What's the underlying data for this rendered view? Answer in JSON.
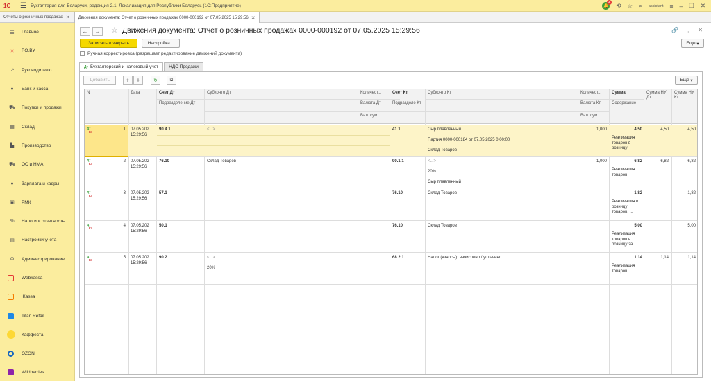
{
  "app": {
    "logo": "1С",
    "title": "Бухгалтерия для Беларуси, редакция 2.1. Локализация для Республики Беларусь  (1С:Предприятие)",
    "notif_count": "4",
    "user": "assistant"
  },
  "tabs": [
    {
      "label": "Отчеты о розничных продажах"
    },
    {
      "label": "Движения документа: Отчет о розничных продажах 0000-000192 от 07.05.2025 15:29:56"
    }
  ],
  "sidebar": {
    "items": [
      {
        "label": "Главное",
        "icon": "menu-icon"
      },
      {
        "label": "PO.BY",
        "icon": "asterisk-icon"
      },
      {
        "label": "Руководителю",
        "icon": "trend-icon"
      },
      {
        "label": "Банк и касса",
        "icon": "coin-icon"
      },
      {
        "label": "Покупки и продажи",
        "icon": "cart-icon"
      },
      {
        "label": "Склад",
        "icon": "warehouse-icon"
      },
      {
        "label": "Производство",
        "icon": "factory-icon"
      },
      {
        "label": "ОС и НМА",
        "icon": "truck-icon"
      },
      {
        "label": "Зарплата и кадры",
        "icon": "person-icon"
      },
      {
        "label": "РМК",
        "icon": "register-icon"
      },
      {
        "label": "Налоги и отчетность",
        "icon": "tax-icon"
      },
      {
        "label": "Настройки учета",
        "icon": "settings-doc-icon"
      },
      {
        "label": "Администрирование",
        "icon": "gear-icon"
      },
      {
        "label": "Webkassa",
        "icon": "webkassa-icon",
        "color": "#e53935"
      },
      {
        "label": "iKassa",
        "icon": "ikassa-icon",
        "color": "#f57c00"
      },
      {
        "label": "Titan Retail",
        "icon": "titan-icon",
        "color": "#1e88e5"
      },
      {
        "label": "Каффеста",
        "icon": "kaffesta-icon",
        "color": "#fdd835"
      },
      {
        "label": "OZON",
        "icon": "ozon-icon",
        "color": "#1565c0"
      },
      {
        "label": "Wildberries",
        "icon": "wb-icon",
        "color": "#8e24aa"
      }
    ]
  },
  "doc": {
    "title": "Движения документа: Отчет о розничных продажах 0000-000192 от 07.05.2025 15:29:56",
    "save_close": "Записать и закрыть",
    "settings": "Настройка...",
    "more": "Еще",
    "manual_correction": "Ручная корректировка (разрешает редактирование движений документа)",
    "tab_accounting": "Бухгалтерский и налоговый учет",
    "tab_vat": "НДС Продажи",
    "add": "Добавить",
    "dtkt_dt": "Дт",
    "dtkt_kt": "Кт"
  },
  "columns": {
    "n": "N",
    "date": "Дата",
    "acc_dt": "Счет Дт",
    "subdiv_dt": "Подразделение Дт",
    "subconto_dt": "Субконто Дт",
    "qty_dt": "Количест...",
    "currency_dt": "Валюта Дт",
    "val_sum_dt": "Вал. сум...",
    "acc_kt": "Счет Кт",
    "subdiv_kt": "Подразделе Кт",
    "subconto_kt": "Субконто Кт",
    "qty_kt": "Количест...",
    "currency_kt": "Валюта Кт",
    "val_sum_kt": "Вал. сум...",
    "sum": "Сумма",
    "content": "Содержание",
    "sum_nu_dt": "Сумма НУ Дт",
    "sum_nu_kt": "Сумма НУ Кт"
  },
  "rows": [
    {
      "n": "1",
      "date1": "07.05.202",
      "date2": "15:29:56",
      "acc_dt": "90.4.1",
      "sub_dt": [
        "<...>",
        "",
        ""
      ],
      "qty_dt": "",
      "acc_kt": "41.1",
      "sub_kt": [
        "Сыр плавленный",
        "Партия 0000-000184 от 07.05.2025 0:00:00",
        "Склад Товаров"
      ],
      "qty_kt": "1,000",
      "sum": "4,50",
      "content": "Реализация товаров в розницу",
      "nu_dt": "4,50",
      "nu_kt": "4,50"
    },
    {
      "n": "2",
      "date1": "07.05.202",
      "date2": "15:29:56",
      "acc_dt": "76.10",
      "sub_dt": [
        "Склад Товаров",
        "",
        ""
      ],
      "qty_dt": "",
      "acc_kt": "90.1.1",
      "sub_kt": [
        "<...>",
        "20%",
        "Сыр плавленный"
      ],
      "qty_kt": "1,000",
      "sum": "6,82",
      "content": "Реализация товаров",
      "nu_dt": "6,82",
      "nu_kt": "6,82"
    },
    {
      "n": "3",
      "date1": "07.05.202",
      "date2": "15:29:56",
      "acc_dt": "57.1",
      "sub_dt": [
        "",
        "",
        ""
      ],
      "qty_dt": "",
      "acc_kt": "76.10",
      "sub_kt": [
        "Склад Товаров",
        "",
        ""
      ],
      "qty_kt": "",
      "sum": "1,82",
      "content": "Реализация в розницу товаров, ...",
      "nu_dt": "",
      "nu_kt": "1,82"
    },
    {
      "n": "4",
      "date1": "07.05.202",
      "date2": "15:29:56",
      "acc_dt": "50.1",
      "sub_dt": [
        "",
        "",
        ""
      ],
      "qty_dt": "",
      "acc_kt": "76.10",
      "sub_kt": [
        "Склад Товаров",
        "",
        ""
      ],
      "qty_kt": "",
      "sum": "5,00",
      "content": "Реализация товаров в розницу за...",
      "nu_dt": "",
      "nu_kt": "5,00"
    },
    {
      "n": "5",
      "date1": "07.05.202",
      "date2": "15:29:56",
      "acc_dt": "90.2",
      "sub_dt": [
        "<...>",
        "20%",
        ""
      ],
      "qty_dt": "",
      "acc_kt": "68.2.1",
      "sub_kt": [
        "Налог (взносы): начислено / уплачено",
        "",
        ""
      ],
      "qty_kt": "",
      "sum": "1,14",
      "content": "Реализация товаров",
      "nu_dt": "1,14",
      "nu_kt": "1,14"
    }
  ]
}
